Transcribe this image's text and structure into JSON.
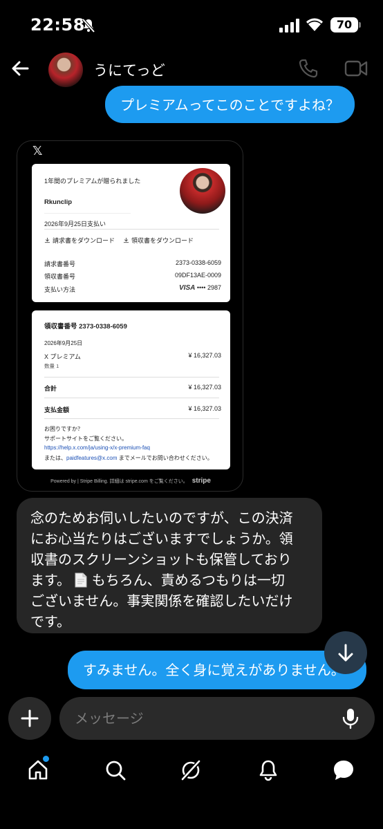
{
  "status": {
    "time": "22:58",
    "battery": "70"
  },
  "header": {
    "name": "うにてっど"
  },
  "messages": {
    "outgoing_1": "プレミアムってこのことですよね？",
    "incoming_1_lines": [
      "念のためお伺いしたいのですが、この決済",
      "にお心当たりはございますでしょうか。領",
      "収書のスクリーンショットも保管しており",
      "ます。",
      "もちろん、責めるつもりは一切",
      "ございません。事実関係を確認したいだけ",
      "です。"
    ],
    "outgoing_2": "すみません。全く身に覚えがありません。"
  },
  "receipt": {
    "x_logo": "𝕏",
    "gift_title": "1年間のプレミアムが贈られました",
    "recipient": "Rkunclip",
    "paid_date": "2026年9月25日支払い",
    "download_invoice": "請求書をダウンロード",
    "download_receipt": "領収書をダウンロード",
    "invoice_number_label": "請求書番号",
    "invoice_number": "2373-0338-6059",
    "receipt_number_label": "領収書番号",
    "receipt_number": "09DF13AE-0009",
    "payment_method_label": "支払い方法",
    "card_brand": "VISA",
    "card_last4": "•••• 2987",
    "receipt_heading": "領収書番号 2373-0338-6059",
    "date": "2026年9月25日",
    "item_name": "X プレミアム",
    "item_qty": "数量 1",
    "item_price": "¥ 16,327.03",
    "total_label": "合計",
    "total": "¥ 16,327.03",
    "amount_paid_label": "支払金額",
    "amount_paid": "¥ 16,327.03",
    "help_1": "お困りですか？",
    "help_2": "サポートサイトをご覧ください。",
    "help_link": "https://help.x.com/ja/using-x/x-premium-faq",
    "help_3_prefix": "または、",
    "help_email": "paidfeatures@x.com",
    "help_3_suffix": " までメールでお問い合わせください。",
    "footer_text": "Powered by  |  Stripe Billing. 詳細は stripe.com をご覧ください。",
    "footer_brand": "stripe"
  },
  "composer": {
    "placeholder": "メッセージ"
  },
  "colors": {
    "accent": "#1d9bf0",
    "incoming_bg": "#262626",
    "background": "#000000"
  },
  "icons": [
    "back-arrow-icon",
    "phone-icon",
    "video-camera-icon",
    "arrow-down-icon",
    "plus-icon",
    "microphone-icon",
    "home-icon",
    "search-icon",
    "grok-icon",
    "bell-icon",
    "messages-icon"
  ]
}
